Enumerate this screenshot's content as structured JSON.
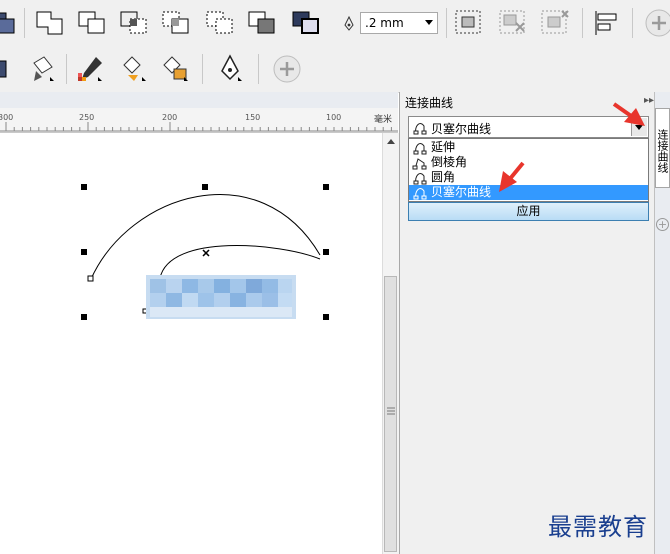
{
  "toolbar": {
    "outline_width_value": ".2 mm"
  },
  "ruler": {
    "ticks": [
      "300",
      "250",
      "200",
      "150",
      "100"
    ],
    "unit": "毫米"
  },
  "docker": {
    "title": "连接曲线",
    "combo_value": "贝塞尔曲线",
    "options": [
      "延伸",
      "倒棱角",
      "圆角",
      "贝塞尔曲线"
    ],
    "selected_option": "贝塞尔曲线",
    "apply_label": "应用",
    "side_tab_label": "连接曲线"
  },
  "watermark": "最需教育",
  "colors": {
    "selection_blue": "#3399ff",
    "annotation_red": "#e8352c",
    "watermark_blue": "#1a3f8f"
  },
  "icons": [
    "node-tool-icon",
    "outline-pen-icon",
    "eyedropper-icon",
    "fill-icon",
    "add-icon",
    "curve-node-icon"
  ]
}
